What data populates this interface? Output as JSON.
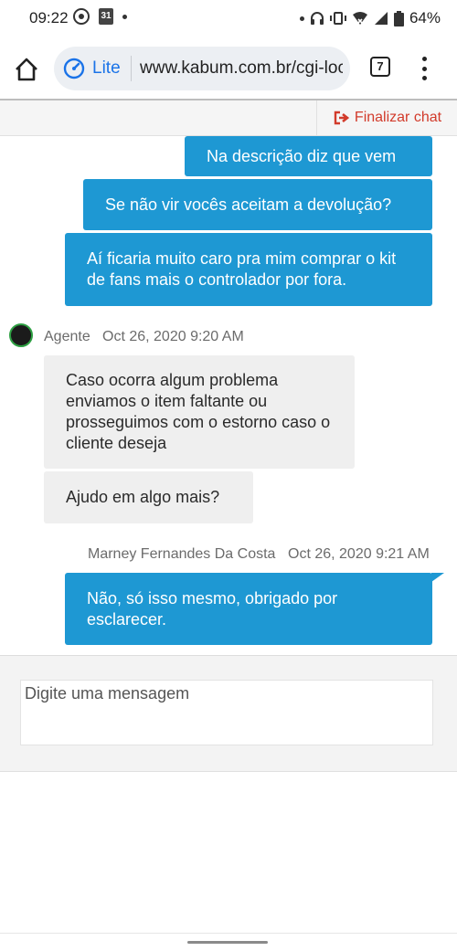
{
  "status_bar": {
    "time": "09:22",
    "calendar_day": "31",
    "battery": "64%"
  },
  "browser": {
    "lite_label": "Lite",
    "url": "www.kabum.com.br/cgi-local/",
    "tab_count": "7"
  },
  "chat": {
    "end_chat_label": "Finalizar chat",
    "messages_top": [
      {
        "text": "Na descrição diz que vem"
      },
      {
        "text": "Se não vir vocês aceitam a devolução?"
      },
      {
        "text": "Aí ficaria muito caro pra mim comprar o kit de fans mais o controlador por fora."
      }
    ],
    "agent": {
      "name": "Agente",
      "timestamp": "Oct 26, 2020 9:20 AM",
      "messages": [
        {
          "text": "Caso ocorra algum problema enviamos o item faltante ou prosseguimos com o estorno caso o cliente deseja"
        },
        {
          "text": "Ajudo em algo mais?"
        }
      ]
    },
    "user": {
      "name": "Marney Fernandes Da Costa",
      "timestamp": "Oct 26, 2020 9:21 AM",
      "messages": [
        {
          "text": "Não, só isso mesmo, obrigado por esclarecer."
        }
      ]
    }
  },
  "composer": {
    "placeholder": "Digite uma mensagem"
  },
  "colors": {
    "outgoing_bubble": "#1e98d3",
    "incoming_bubble": "#efefef",
    "end_chat": "#d23b2b",
    "lite_accent": "#1a73e8"
  }
}
